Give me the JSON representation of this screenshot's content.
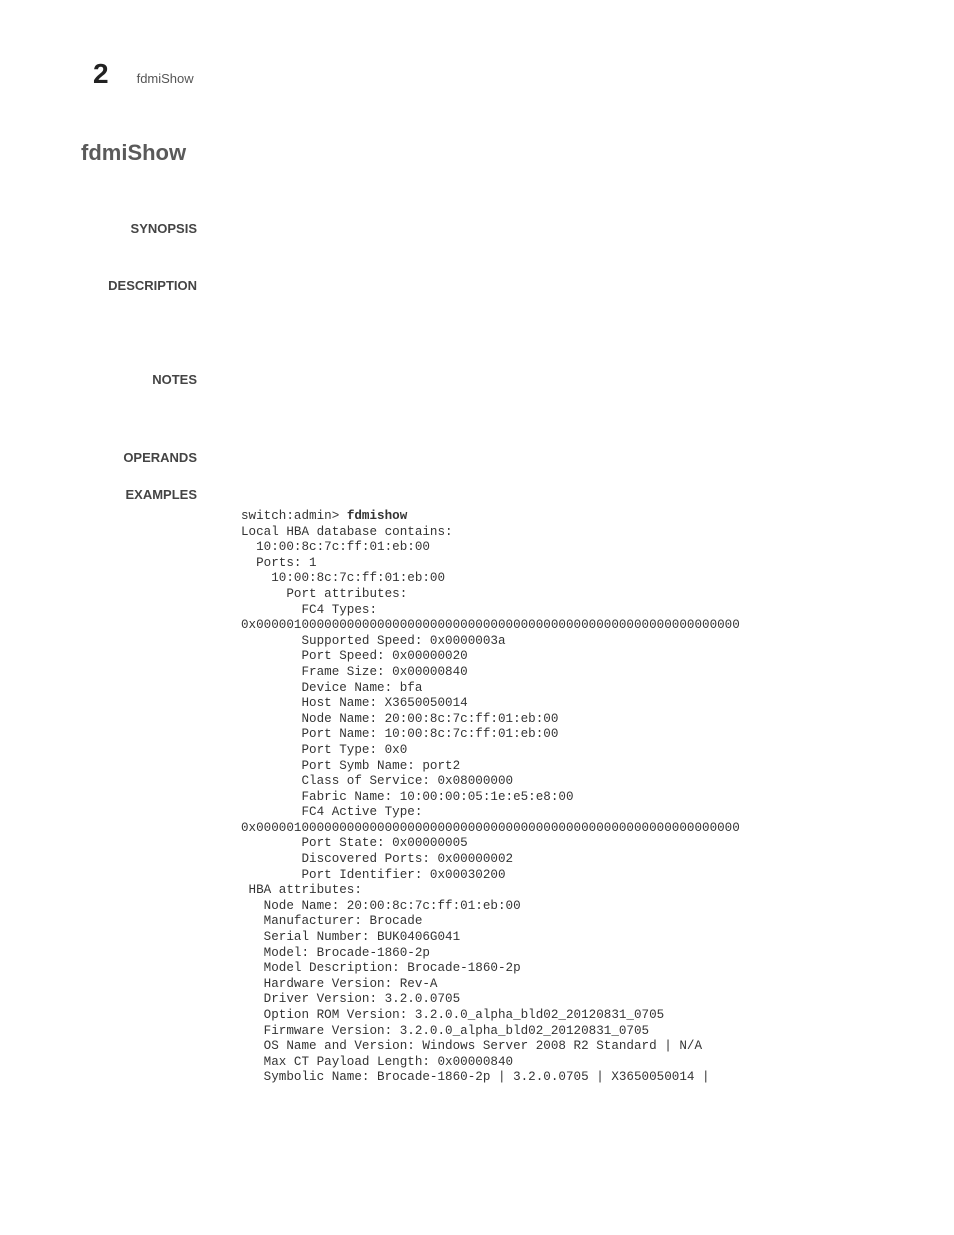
{
  "header": {
    "chapter": "2",
    "title": "fdmiShow"
  },
  "heading": "fdmiShow",
  "sections": {
    "synopsis": "SYNOPSIS",
    "description": "DESCRIPTION",
    "notes": "NOTES",
    "operands": "OPERANDS",
    "examples": "EXAMPLES"
  },
  "example": {
    "prompt": "switch:admin> ",
    "command": "fdmishow",
    "body": "Local HBA database contains:\n  10:00:8c:7c:ff:01:eb:00\n  Ports: 1\n    10:00:8c:7c:ff:01:eb:00\n      Port attributes:\n        FC4 Types: \n0x0000010000000000000000000000000000000000000000000000000000000000\n        Supported Speed: 0x0000003a\n        Port Speed: 0x00000020\n        Frame Size: 0x00000840\n        Device Name: bfa\n        Host Name: X3650050014\n        Node Name: 20:00:8c:7c:ff:01:eb:00\n        Port Name: 10:00:8c:7c:ff:01:eb:00\n        Port Type: 0x0\n        Port Symb Name: port2\n        Class of Service: 0x08000000\n        Fabric Name: 10:00:00:05:1e:e5:e8:00\n        FC4 Active Type: \n0x0000010000000000000000000000000000000000000000000000000000000000\n        Port State: 0x00000005\n        Discovered Ports: 0x00000002\n        Port Identifier: 0x00030200\n HBA attributes:\n   Node Name: 20:00:8c:7c:ff:01:eb:00\n   Manufacturer: Brocade\n   Serial Number: BUK0406G041\n   Model: Brocade-1860-2p\n   Model Description: Brocade-1860-2p\n   Hardware Version: Rev-A\n   Driver Version: 3.2.0.0705\n   Option ROM Version: 3.2.0.0_alpha_bld02_20120831_0705\n   Firmware Version: 3.2.0.0_alpha_bld02_20120831_0705\n   OS Name and Version: Windows Server 2008 R2 Standard | N/A\n   Max CT Payload Length: 0x00000840\n   Symbolic Name: Brocade-1860-2p | 3.2.0.0705 | X3650050014 |"
  }
}
